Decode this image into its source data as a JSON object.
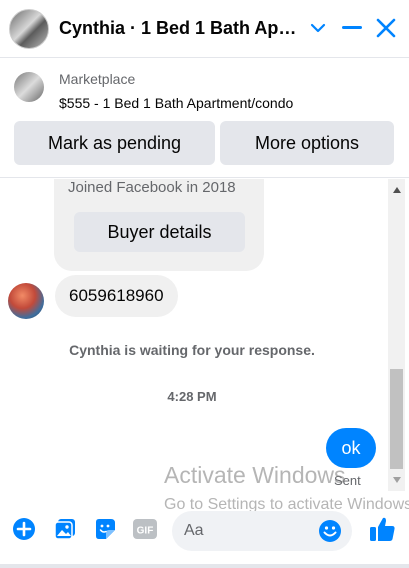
{
  "header": {
    "title": "Cynthia · 1 Bed 1 Bath Apa...",
    "icons": [
      "chevron-down-icon",
      "minimize-icon",
      "close-icon"
    ]
  },
  "marketplace": {
    "label": "Marketplace",
    "listing": "$555 - 1 Bed 1 Bath Apartment/condo",
    "pending_button": "Mark as pending",
    "more_button": "More options"
  },
  "chat": {
    "joined": "Joined Facebook in 2018",
    "buyer_button": "Buyer details",
    "phone_message": "6059618960",
    "waiting": "Cynthia is waiting for your response.",
    "time": "4:28 PM",
    "ok_message": "ok",
    "sent_status": "Sent"
  },
  "watermark": {
    "line1": "Activate Windows",
    "line2": "Go to Settings to activate Windows."
  },
  "composer": {
    "placeholder": "Aa",
    "icons": [
      "plus-icon",
      "photo-icon",
      "sticker-icon",
      "gif-icon",
      "emoji-icon",
      "like-icon"
    ]
  },
  "colors": {
    "accent": "#0084ff",
    "bubble_gray": "#f0f0f0",
    "button_gray": "#e4e6eb",
    "secondary_text": "#65676b"
  }
}
